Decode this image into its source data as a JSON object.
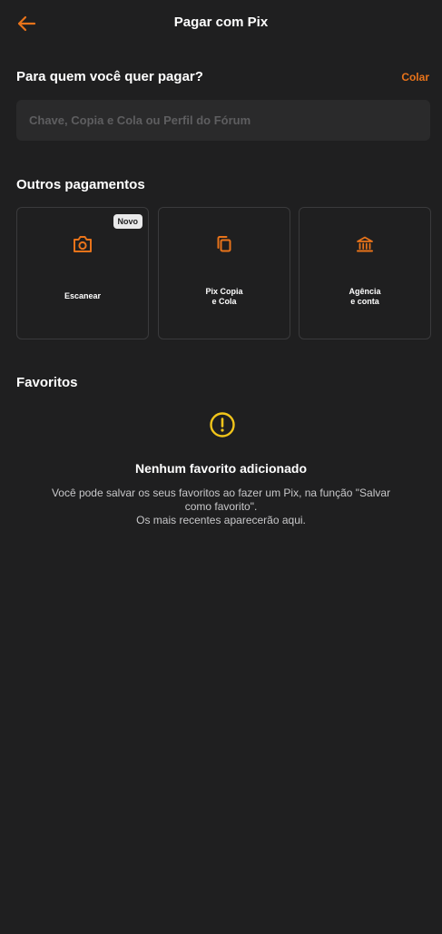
{
  "header": {
    "title": "Pagar com Pix",
    "back_icon": "arrow-left-icon"
  },
  "recipient": {
    "heading": "Para quem você quer pagar?",
    "paste_label": "Colar",
    "input_placeholder": "Chave, Copia e Cola ou Perfil do Fórum",
    "input_value": ""
  },
  "other_payments": {
    "heading": "Outros pagamentos",
    "cards": [
      {
        "label": "Escanear",
        "icon": "camera-icon",
        "badge": "Novo"
      },
      {
        "label_line1": "Pix Copia",
        "label_line2": "e Cola",
        "icon": "copy-icon"
      },
      {
        "label_line1": "Agência",
        "label_line2": "e conta",
        "icon": "bank-icon"
      }
    ]
  },
  "favorites": {
    "heading": "Favoritos",
    "empty_icon": "alert-circle-icon",
    "empty_title": "Nenhum favorito adicionado",
    "empty_line1": "Você pode salvar os seus favoritos ao fazer um Pix, na função \"Salvar",
    "empty_line2": "como favorito\".",
    "empty_line3": "Os mais recentes aparecerão aqui."
  },
  "colors": {
    "accent": "#e8731a",
    "warning": "#f2c51a",
    "background": "#1f1f20"
  }
}
